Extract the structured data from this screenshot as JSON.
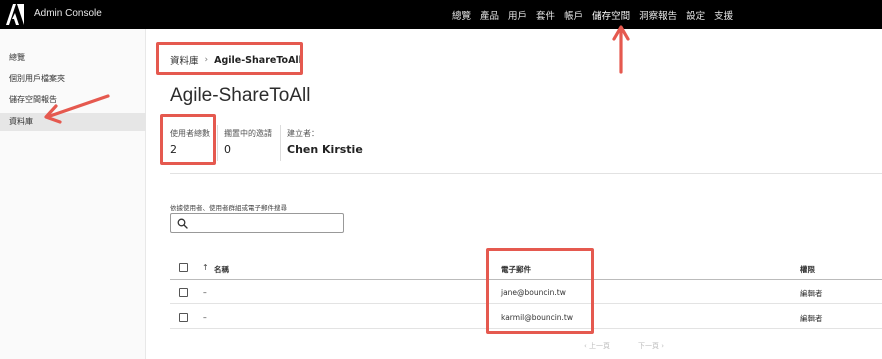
{
  "header": {
    "app_title": "Admin Console",
    "nav": [
      "總覽",
      "產品",
      "用戶",
      "套件",
      "帳戶",
      "儲存空間",
      "洞察報告",
      "設定",
      "支援"
    ],
    "active_nav": "儲存空間"
  },
  "sidebar": {
    "items": [
      "總覽",
      "個別用戶檔案夾",
      "儲存空間報告",
      "資料庫"
    ],
    "active": "資料庫"
  },
  "breadcrumb": {
    "parent": "資料庫",
    "separator": "›",
    "current": "Agile-ShareToAll"
  },
  "page": {
    "title": "Agile-ShareToAll"
  },
  "stats": {
    "users_label": "使用者總數",
    "users_value": "2",
    "pending_label": "擱置中的邀請",
    "pending_value": "0",
    "owner_label": "建立者：",
    "owner_value": "Chen Kirstie"
  },
  "search": {
    "label": "依據使用者、使用者群組或電子郵件搜尋",
    "value": "",
    "placeholder": ""
  },
  "table": {
    "sort_indicator": "↑",
    "headers": {
      "name": "名稱",
      "email": "電子郵件",
      "role": "權限"
    },
    "rows": [
      {
        "name": "–",
        "email": "jane@bouncin.tw",
        "role": "編輯者"
      },
      {
        "name": "–",
        "email": "karmil@bouncin.tw",
        "role": "編輯者"
      }
    ]
  },
  "pagination": {
    "prev": "‹ 上一頁",
    "next": "下一頁 ›"
  },
  "colors": {
    "topbar": "#000000",
    "annotation": "#e5594f",
    "sidebar_active": "#e6e6e6"
  },
  "icons": {
    "logo": "adobe-logo-icon",
    "search": "search-icon",
    "sort": "sort-ascending-icon"
  }
}
